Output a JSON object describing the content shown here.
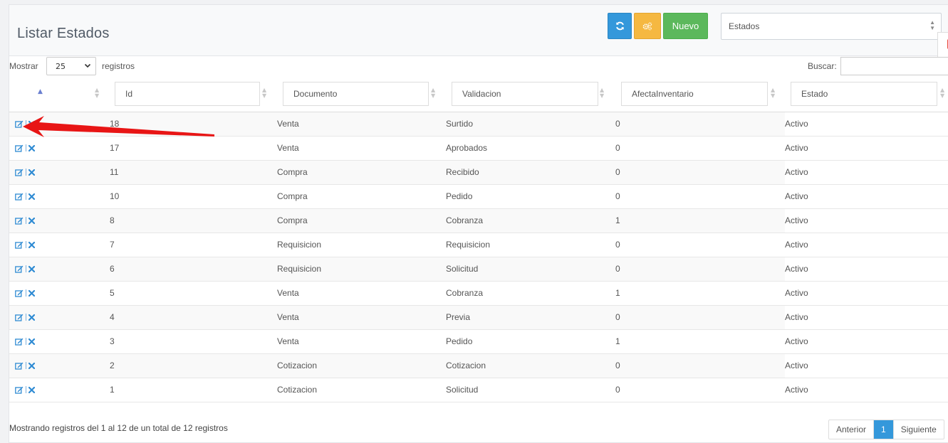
{
  "header": {
    "title": "Listar Estados",
    "new_label": "Nuevo",
    "select_value": "Estados"
  },
  "controls": {
    "show_label": "Mostrar",
    "length_value": "25",
    "records_label": "registros",
    "search_label": "Buscar:"
  },
  "columns": [
    "Id",
    "Documento",
    "Validacion",
    "AfectaInventario",
    "Estado"
  ],
  "rows": [
    {
      "id": "18",
      "documento": "Venta",
      "validacion": "Surtido",
      "afecta": "0",
      "estado": "Activo"
    },
    {
      "id": "17",
      "documento": "Venta",
      "validacion": "Aprobados",
      "afecta": "0",
      "estado": "Activo"
    },
    {
      "id": "11",
      "documento": "Compra",
      "validacion": "Recibido",
      "afecta": "0",
      "estado": "Activo"
    },
    {
      "id": "10",
      "documento": "Compra",
      "validacion": "Pedido",
      "afecta": "0",
      "estado": "Activo"
    },
    {
      "id": "8",
      "documento": "Compra",
      "validacion": "Cobranza",
      "afecta": "1",
      "estado": "Activo"
    },
    {
      "id": "7",
      "documento": "Requisicion",
      "validacion": "Requisicion",
      "afecta": "0",
      "estado": "Activo"
    },
    {
      "id": "6",
      "documento": "Requisicion",
      "validacion": "Solicitud",
      "afecta": "0",
      "estado": "Activo"
    },
    {
      "id": "5",
      "documento": "Venta",
      "validacion": "Cobranza",
      "afecta": "1",
      "estado": "Activo"
    },
    {
      "id": "4",
      "documento": "Venta",
      "validacion": "Previa",
      "afecta": "0",
      "estado": "Activo"
    },
    {
      "id": "3",
      "documento": "Venta",
      "validacion": "Pedido",
      "afecta": "1",
      "estado": "Activo"
    },
    {
      "id": "2",
      "documento": "Cotizacion",
      "validacion": "Cotizacion",
      "afecta": "0",
      "estado": "Activo"
    },
    {
      "id": "1",
      "documento": "Cotizacion",
      "validacion": "Solicitud",
      "afecta": "0",
      "estado": "Activo"
    }
  ],
  "footer": {
    "info": "Mostrando registros del 1 al 12 de un total de 12 registros",
    "prev": "Anterior",
    "page": "1",
    "next": "Siguiente"
  },
  "colors": {
    "refresh": "#3498db",
    "gear": "#f5b841",
    "new": "#5cb85c",
    "icon_blue": "#2f8bd3",
    "arrow": "#e81515"
  },
  "icons": {
    "refresh": "refresh-icon",
    "gear": "gears-icon",
    "edit": "edit-icon",
    "delete": "delete-icon"
  }
}
